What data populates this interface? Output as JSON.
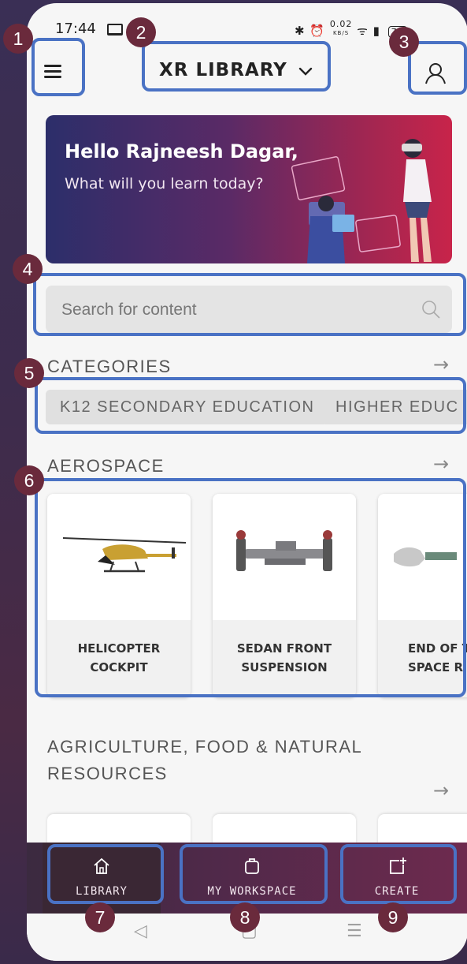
{
  "status_bar": {
    "time": "17:44",
    "speed": "0.02",
    "speed_unit": "KB/S",
    "battery": "73"
  },
  "app_bar": {
    "title": "XR LIBRARY"
  },
  "banner": {
    "greeting": "Hello Rajneesh Dagar,",
    "subtitle": "What will you learn today?"
  },
  "search": {
    "placeholder": "Search for content"
  },
  "categories": {
    "title": "CATEGORIES",
    "chips": [
      "K12 SECONDARY EDUCATION",
      "HIGHER EDUC"
    ]
  },
  "aerospace": {
    "title": "AEROSPACE",
    "cards": [
      {
        "line1": "HELICOPTER",
        "line2": "COCKPIT"
      },
      {
        "line1": "SEDAN FRONT",
        "line2": "SUSPENSION"
      },
      {
        "line1": "END OF T",
        "line2": "SPACE R"
      }
    ]
  },
  "agriculture": {
    "title": "AGRICULTURE, FOOD & NATURAL RESOURCES"
  },
  "bottom_nav": {
    "library": "LIBRARY",
    "workspace": "MY WORKSPACE",
    "create": "CREATE"
  },
  "badges": [
    "1",
    "2",
    "3",
    "4",
    "5",
    "6",
    "7",
    "8",
    "9"
  ],
  "colors": {
    "callout": "#4a72c4",
    "badge": "#6a2a3c",
    "nav_bg": "#51294a"
  }
}
